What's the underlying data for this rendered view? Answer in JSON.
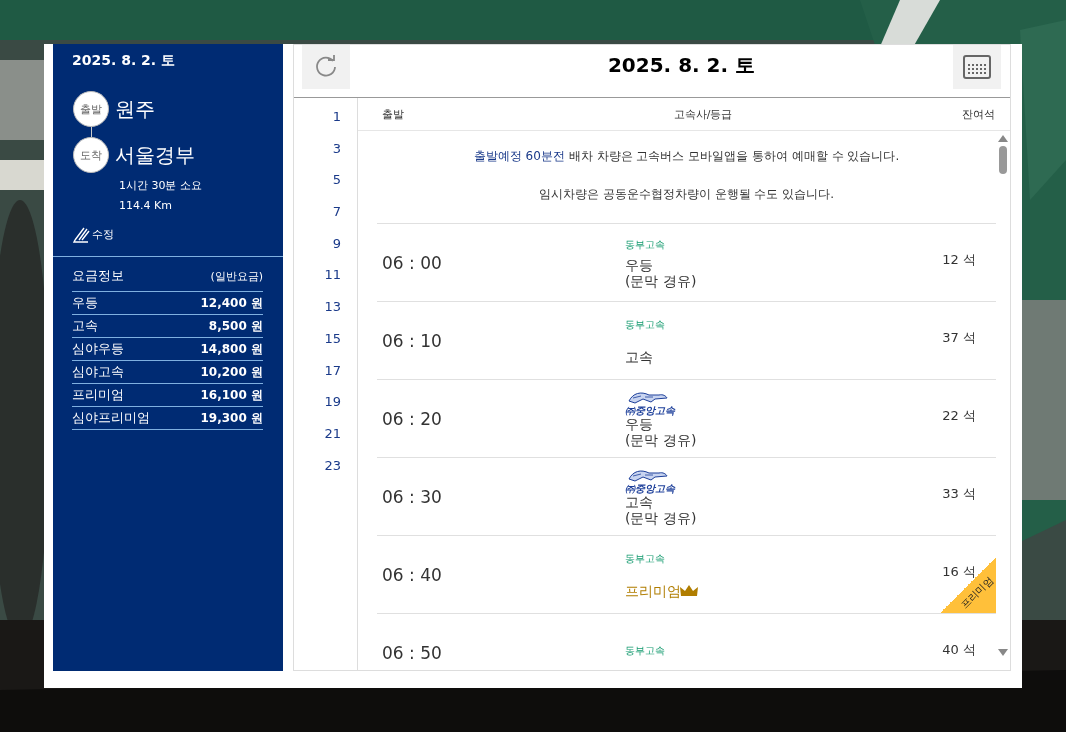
{
  "sidebar": {
    "date": "2025. 8. 2. 토",
    "departure": {
      "badge": "출발",
      "city": "원주"
    },
    "arrival": {
      "badge": "도착",
      "city": "서울경부"
    },
    "duration": "1시간 30분 소요",
    "distance": "114.4 Km",
    "edit": "수정",
    "fares": {
      "title": "요금정보",
      "note": "(일반요금)",
      "rows": [
        {
          "grade": "우등",
          "price": "12,400 원"
        },
        {
          "grade": "고속",
          "price": "8,500 원"
        },
        {
          "grade": "심야우등",
          "price": "14,800 원"
        },
        {
          "grade": "심야고속",
          "price": "10,200 원"
        },
        {
          "grade": "프리미엄",
          "price": "16,100 원"
        },
        {
          "grade": "심야프리미엄",
          "price": "19,300 원"
        }
      ]
    }
  },
  "schedule": {
    "title": "2025. 8. 2. 토",
    "hours": [
      "1",
      "3",
      "5",
      "7",
      "9",
      "11",
      "13",
      "15",
      "17",
      "19",
      "21",
      "23"
    ],
    "columns": [
      "출발",
      "고속사/등급",
      "잔여석"
    ],
    "notices": [
      {
        "highlight": "출발예정 60분전",
        "text": " 배차 차량은 고속버스 모바일앱을 통하여 예매할 수 있습니다."
      },
      {
        "text": "임시차량은 공동운수협정차량이 운행될 수도 있습니다."
      }
    ],
    "rows": [
      {
        "time": "06 : 00",
        "company": {
          "kind": "text",
          "name": "동부고속"
        },
        "grade": "우등",
        "via": "(문막 경유)",
        "seats": "12 석",
        "premium": false
      },
      {
        "time": "06 : 10",
        "company": {
          "kind": "text",
          "name": "동부고속"
        },
        "grade": "고속",
        "seats": "37 석",
        "premium": false
      },
      {
        "time": "06 : 20",
        "company": {
          "kind": "logo",
          "name": "㈜중앙고속"
        },
        "grade": "우등",
        "via": "(문막 경유)",
        "seats": "22 석",
        "premium": false
      },
      {
        "time": "06 : 30",
        "company": {
          "kind": "logo",
          "name": "㈜중앙고속"
        },
        "grade": "고속",
        "via": "(문막 경유)",
        "seats": "33 석",
        "premium": false
      },
      {
        "time": "06 : 40",
        "company": {
          "kind": "text",
          "name": "동부고속"
        },
        "grade": "프리미엄",
        "seats": "16 석",
        "premium": true,
        "ribbon": "프리미엄"
      },
      {
        "time": "06 : 50",
        "company": {
          "kind": "text",
          "name": "동부고속"
        },
        "seats": "40 석"
      }
    ]
  }
}
